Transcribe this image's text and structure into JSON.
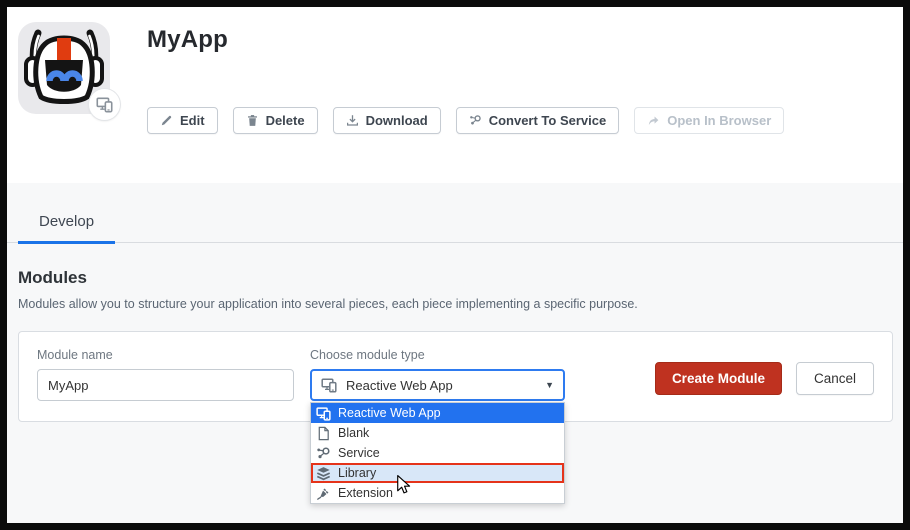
{
  "app": {
    "title": "MyApp",
    "icon": "robot-helmet-icon",
    "icon_badge": "devices-icon"
  },
  "toolbar": {
    "edit": "Edit",
    "delete": "Delete",
    "download": "Download",
    "convert": "Convert To Service",
    "open_in_browser": "Open In Browser",
    "open_in_browser_disabled": true
  },
  "tabs": {
    "develop": "Develop",
    "active_tab": "Develop"
  },
  "modules": {
    "heading": "Modules",
    "description": "Modules allow you to structure your application into several pieces, each piece implementing a specific purpose."
  },
  "form": {
    "module_name_label": "Module name",
    "module_name_value": "MyApp",
    "module_type_label": "Choose module type",
    "module_type_selected": "Reactive Web App",
    "create_button": "Create Module",
    "cancel_button": "Cancel"
  },
  "dropdown": {
    "options": [
      {
        "label": "Reactive Web App",
        "icon": "devices-icon",
        "state": "selected"
      },
      {
        "label": "Blank",
        "icon": "blank-page-icon",
        "state": "normal"
      },
      {
        "label": "Service",
        "icon": "service-nodes-icon",
        "state": "normal"
      },
      {
        "label": "Library",
        "icon": "library-layers-icon",
        "state": "hover-with-red-annotation"
      },
      {
        "label": "Extension",
        "icon": "extension-plug-icon",
        "state": "normal"
      }
    ]
  },
  "colors": {
    "tab_accent": "#1a73e8",
    "select_focus_border": "#2e7bf0",
    "dropdown_selected_bg": "#2272ef",
    "library_hover_bg": "#d8e7f8",
    "annotation_red": "#e5331a",
    "primary_button_red": "#bf3220",
    "section_gray": "#f7f8f9",
    "app_icon_red_stripe": "#e03c10",
    "app_icon_eye_blue": "#4a86e8"
  }
}
